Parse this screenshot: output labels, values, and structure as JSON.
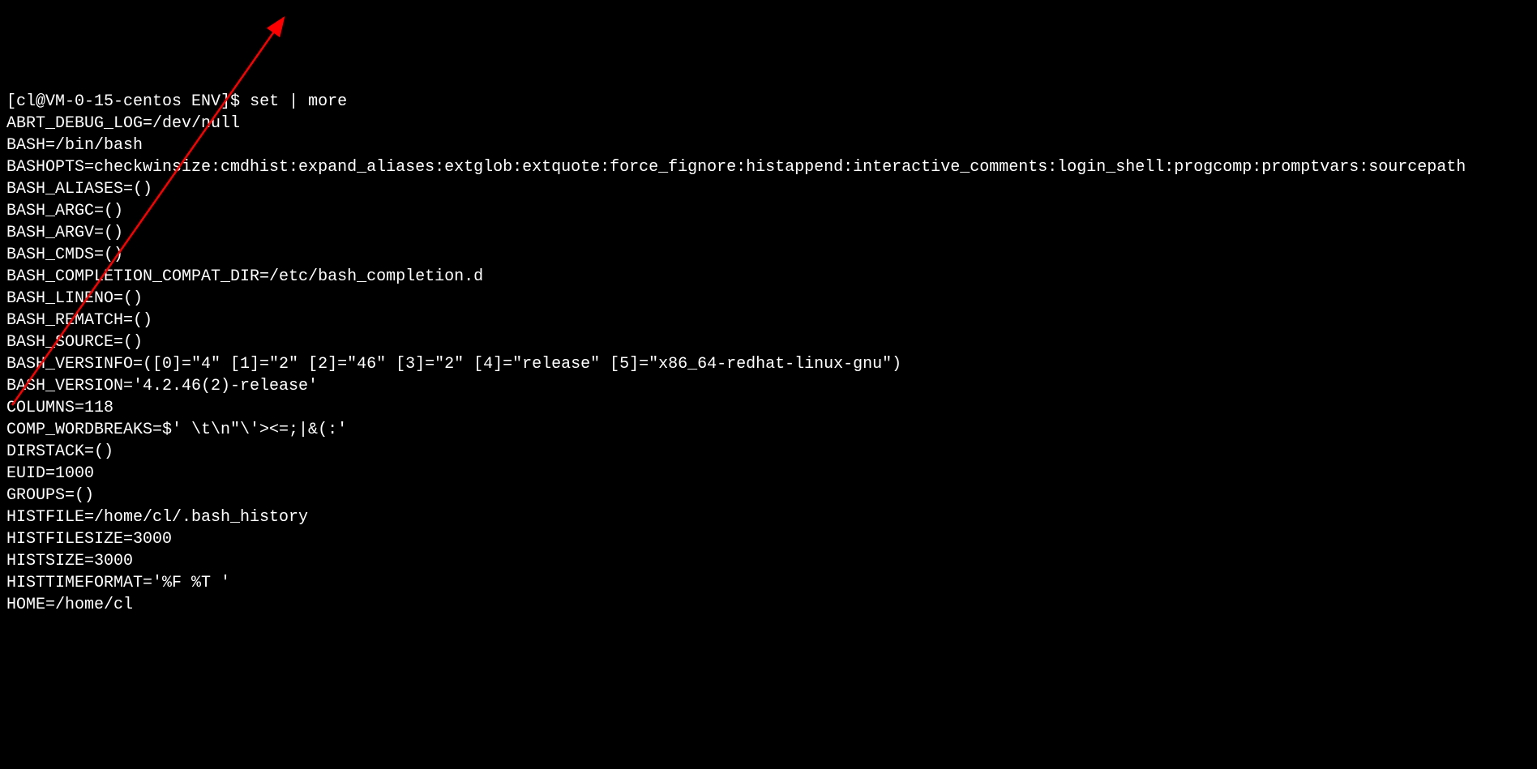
{
  "terminal": {
    "prompt": "[cl@VM-0-15-centos ENV]$ ",
    "command": "set | more",
    "lines": [
      "ABRT_DEBUG_LOG=/dev/null",
      "BASH=/bin/bash",
      "BASHOPTS=checkwinsize:cmdhist:expand_aliases:extglob:extquote:force_fignore:histappend:interactive_comments:login_shell:progcomp:promptvars:sourcepath",
      "BASH_ALIASES=()",
      "BASH_ARGC=()",
      "BASH_ARGV=()",
      "BASH_CMDS=()",
      "BASH_COMPLETION_COMPAT_DIR=/etc/bash_completion.d",
      "BASH_LINENO=()",
      "BASH_REMATCH=()",
      "BASH_SOURCE=()",
      "BASH_VERSINFO=([0]=\"4\" [1]=\"2\" [2]=\"46\" [3]=\"2\" [4]=\"release\" [5]=\"x86_64-redhat-linux-gnu\")",
      "BASH_VERSION='4.2.46(2)-release'",
      "COLUMNS=118",
      "COMP_WORDBREAKS=$' \\t\\n\"\\'><=;|&(:'",
      "DIRSTACK=()",
      "EUID=1000",
      "GROUPS=()",
      "HISTFILE=/home/cl/.bash_history",
      "HISTFILESIZE=3000",
      "HISTSIZE=3000",
      "HISTTIMEFORMAT='%F %T '",
      "HOME=/home/cl"
    ]
  },
  "annotation": {
    "arrow_color": "#ff0000"
  }
}
